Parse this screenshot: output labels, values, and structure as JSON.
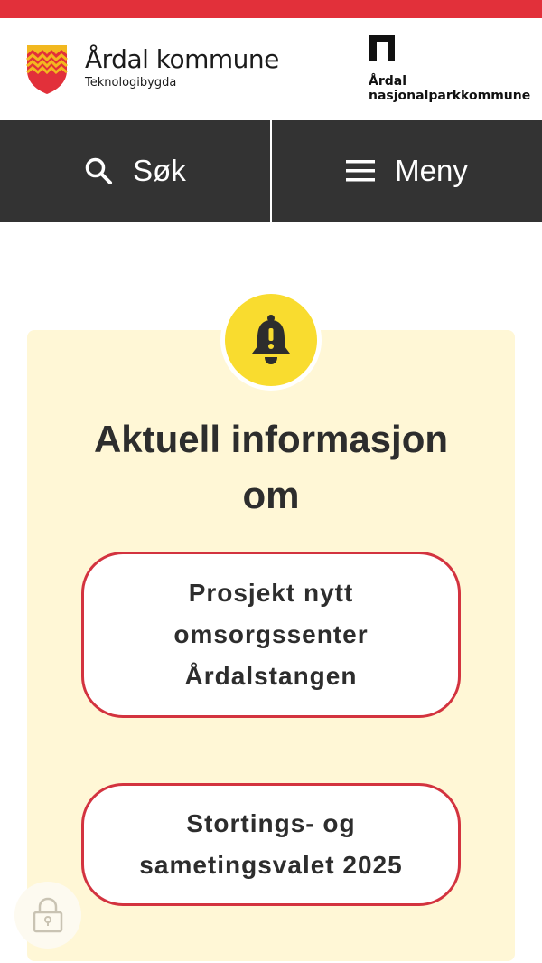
{
  "header": {
    "municipality_name": "Årdal kommune",
    "tagline": "Teknologibygda",
    "park_line1": "Årdal",
    "park_line2": "nasjonalparkkommune"
  },
  "nav": {
    "search_label": "Søk",
    "menu_label": "Meny"
  },
  "alert": {
    "title": "Aktuell informasjon om",
    "links": [
      {
        "label": "Prosjekt nytt omsorgssenter Årdalstangen"
      },
      {
        "label": "Stortings- og sametingsvalet 2025"
      }
    ]
  },
  "icons": {
    "crest": "crest-icon",
    "park_logo": "national-park-logo-icon",
    "search": "search-icon",
    "menu": "hamburger-menu-icon",
    "bell": "warning-bell-icon",
    "lock": "lock-icon"
  },
  "colors": {
    "accent_red": "#e2303a",
    "nav_bg": "#333333",
    "alert_bg": "#fff7d6",
    "bell_yellow": "#f9dc2f",
    "pill_border": "#d3333f"
  }
}
